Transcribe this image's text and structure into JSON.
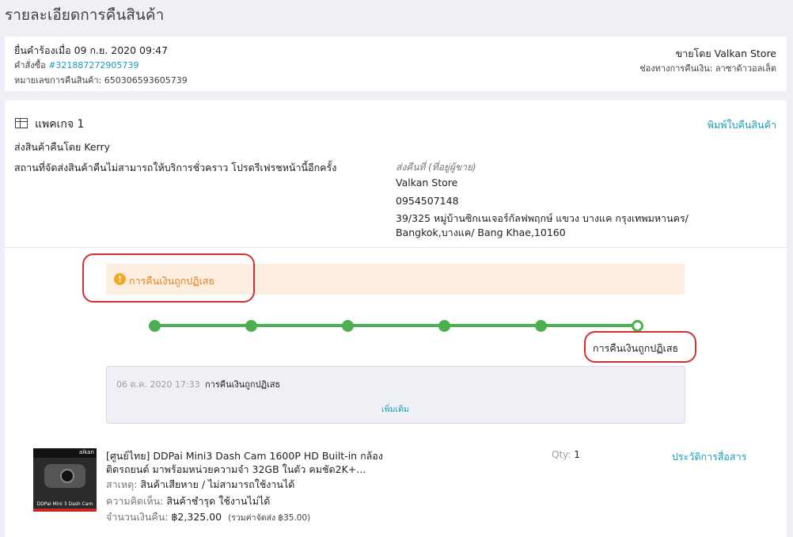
{
  "page_title": "รายละเอียดการคืนสินค้า",
  "summary": {
    "submitted": "ยื่นคำร้องเมื่อ 09 ก.ย. 2020 09:47",
    "order_label": "คำสั่งซื้อ",
    "order_number": "#321887272905739",
    "return_number": "หมายเลขการคืนสินค้า: 650306593605739",
    "sold_by": "ขายโดย Valkan Store",
    "refund_channel": "ช่องทางการคืนเงิน: ลาซาด้าวอลเล็ต"
  },
  "package": {
    "title": "แพคเกจ 1",
    "print_link": "พิมพ์ใบคืนสินค้า",
    "courier": "ส่งสินค้าคืนโดย Kerry",
    "notice": "สถานที่จัดส่งสินค้าคืนไม่สามารถให้บริการชั่วคราว โปรดรีเฟรชหน้านี้อีกครั้ง",
    "address_header": "ส่งคืนที่ (ที่อยู่ผู้ขาย)",
    "address_name": "Valkan Store",
    "address_phone": "0954507148",
    "address_line1": "39/325 หมู่บ้านซิกเนเจอร์กัลฟพฤกษ์ แขวง บางแค กรุงเทพมหานคร/",
    "address_line2": "Bangkok,บางแค/ Bang Khae,10160"
  },
  "status_banner": {
    "text": "การคืนเงินถูกปฏิเสธ",
    "icon": "exclamation-icon",
    "color": "#f5a623"
  },
  "tracker": {
    "steps_total": 6,
    "steps_completed": 5,
    "current_label": "การคืนเงินถูกปฏิเสธ",
    "color": "#4caf50"
  },
  "history": {
    "timestamp": "06 ต.ค. 2020 17:33",
    "event": "การคืนเงินถูกปฏิเสธ",
    "more_link": "เพิ่มเติม"
  },
  "item": {
    "thumb_brand": "alkan",
    "thumb_caption": "DDPai Mini 3 Dash Cam",
    "name_line1": "[ศูนย์ไทย] DDPai Mini3 Dash Cam 1600P HD Built-in กล้อง",
    "name_line2": "ติดรถยนต์ มาพร้อมหน่วยความจำ 32GB ในตัว คมชัด2K+...",
    "qty_label": "Qty:",
    "qty_value": "1",
    "comm_link": "ประวัติการสื่อสาร",
    "reason_label": "สาเหตุ:",
    "reason_value": "สินค้าเสียหาย / ไม่สามารถใช้งานได้",
    "comment_label": "ความคิดเห็น:",
    "comment_value": "สินค้าชำรุด ใช้งานไม่ได้",
    "amount_label": "จำนวนเงินคืน:",
    "amount_value": "฿2,325.00",
    "shipping_note": "(รวมค่าจัดส่ง ฿35.00)"
  }
}
